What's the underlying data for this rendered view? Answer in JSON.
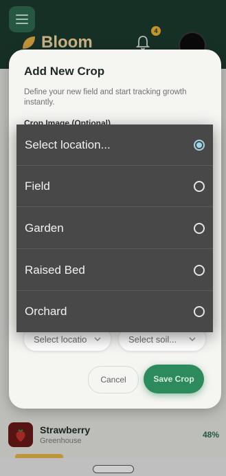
{
  "app": {
    "brand": "Bloom",
    "notification_count": "4"
  },
  "crop_card": {
    "name": "Strawberry",
    "location": "Greenhouse",
    "progress": "48%"
  },
  "modal": {
    "title": "Add New Crop",
    "description": "Define your new field and start tracking growth instantly.",
    "image_label": "Crop Image (Optional)",
    "location_select": "Select locatio",
    "soil_select": "Select soil...",
    "cancel_label": "Cancel",
    "save_label": "Save Crop"
  },
  "picker": {
    "options": [
      {
        "label": "Select location...",
        "selected": true
      },
      {
        "label": "Field",
        "selected": false
      },
      {
        "label": "Garden",
        "selected": false
      },
      {
        "label": "Raised Bed",
        "selected": false
      },
      {
        "label": "Orchard",
        "selected": false
      }
    ]
  },
  "colors": {
    "header": "#1d3b2e",
    "accent": "#2d8a5c",
    "radio_selected": "#9fd6e6"
  }
}
